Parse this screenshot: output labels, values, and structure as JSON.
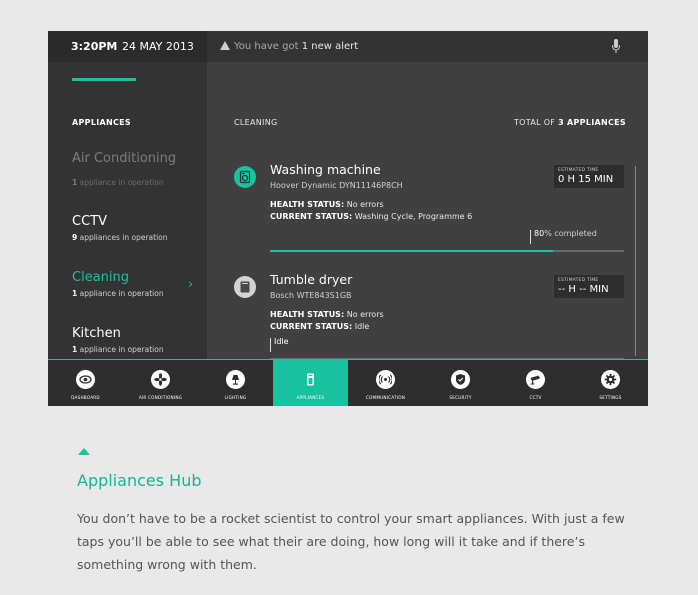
{
  "statusbar": {
    "time": "3:20PM",
    "date": "24 MAY 2013",
    "alert_prefix": "You have got",
    "alert_count": "1 new alert",
    "alert_icon": "warning-icon",
    "mic_icon": "microphone-icon"
  },
  "sidebar": {
    "title": "APPLIANCES",
    "items": [
      {
        "name": "Air Conditioning",
        "count": "1",
        "sub": "appliance in operation"
      },
      {
        "name": "CCTV",
        "count": "9",
        "sub": "appliances in operation"
      },
      {
        "name": "Cleaning",
        "count": "1",
        "sub": "appliance in operation",
        "chevron": "›"
      },
      {
        "name": "Kitchen",
        "count": "1",
        "sub": "appliance in operation"
      }
    ]
  },
  "main": {
    "heading": "CLEANING",
    "total_prefix": "TOTAL OF",
    "total_count": "3 APPLIANCES",
    "cards": [
      {
        "title": "Washing machine",
        "model": "Hoover Dynamic DYN11146P8CH",
        "health_label": "HEALTH STATUS:",
        "health_value": "No errors",
        "current_label": "CURRENT STATUS:",
        "current_value": "Washing Cycle, Programme 6",
        "est_caption": "ESTIMATED TIME",
        "est_value": "0 H 15 MIN",
        "progress_pct": "80",
        "progress_suffix": "% completed",
        "icon": "washing-machine-icon"
      },
      {
        "title": "Tumble dryer",
        "model": "Bosch WTE843S1GB",
        "health_label": "HEALTH STATUS:",
        "health_value": "No errors",
        "current_label": "CURRENT STATUS:",
        "current_value": "Idle",
        "est_caption": "ESTIMATED TIME",
        "est_value": "-- H -- MIN",
        "progress_label": "Idle",
        "icon": "dryer-icon"
      }
    ]
  },
  "nav": [
    {
      "label": "DASHBOARD",
      "icon": "eye-icon"
    },
    {
      "label": "AIR CONDITIONING",
      "icon": "fan-icon"
    },
    {
      "label": "LIGHTING",
      "icon": "lamp-icon"
    },
    {
      "label": "APPLIANCES",
      "icon": "appliance-icon",
      "active": true
    },
    {
      "label": "COMMUNICATION",
      "icon": "broadcast-icon"
    },
    {
      "label": "SECURITY",
      "icon": "shield-icon"
    },
    {
      "label": "CCTV",
      "icon": "camera-icon"
    },
    {
      "label": "SETTINGS",
      "icon": "gear-icon"
    }
  ],
  "caption": {
    "title": "Appliances Hub",
    "description": "You don’t have to be a rocket scientist to control your smart appliances. With just a few taps you’ll be able to see what their are doing, how long will it take and if there’s something wrong with them."
  },
  "colors": {
    "accent": "#18c1a0",
    "dark": "#333333",
    "panel": "#404040",
    "page": "#e9e9e9"
  }
}
